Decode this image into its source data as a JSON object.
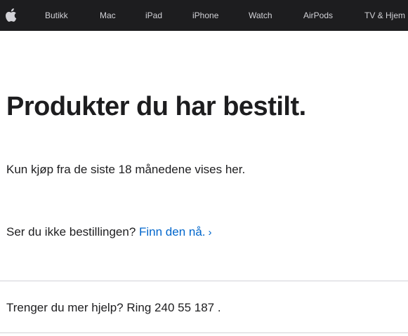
{
  "nav": {
    "logo_icon": "apple-logo-icon",
    "items": [
      "Butikk",
      "Mac",
      "iPad",
      "iPhone",
      "Watch",
      "AirPods",
      "TV & Hjem"
    ]
  },
  "main": {
    "title": "Produkter du har bestilt.",
    "subtitle": "Kun kjøp fra de siste 18 månedene vises her.",
    "missing_prompt": "Ser du ikke bestillingen?",
    "find_link": "Finn den nå.",
    "find_chevron_icon": "chevron-right-icon"
  },
  "help": {
    "text": "Trenger du mer hjelp? Ring 240 55 187 ."
  },
  "colors": {
    "nav_bg": "#1d1d1f",
    "nav_text": "#d2d2d7",
    "link": "#0066cc",
    "text": "#1d1d1f",
    "divider": "#d2d2d7"
  }
}
